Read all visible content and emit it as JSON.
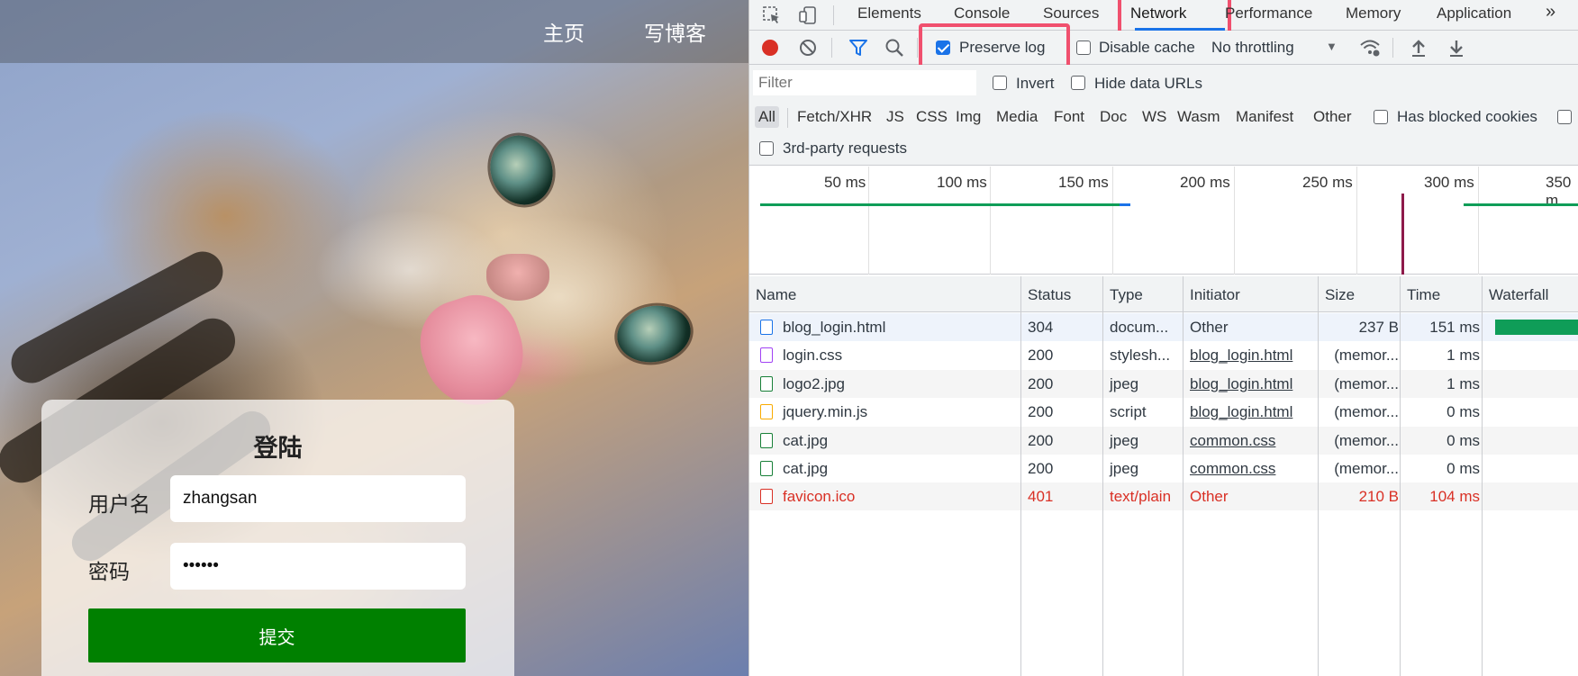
{
  "page": {
    "nav": {
      "home": "主页",
      "write": "写博客"
    },
    "login": {
      "title": "登陆",
      "username_label": "用户名",
      "username_value": "zhangsan",
      "password_label": "密码",
      "password_value": "••••••",
      "submit_label": "提交"
    }
  },
  "devtools": {
    "tabs": [
      "Elements",
      "Console",
      "Sources",
      "Network",
      "Performance",
      "Memory",
      "Application"
    ],
    "active_tab": "Network",
    "more_tabs": "»",
    "toolbar": {
      "preserve_log": "Preserve log",
      "disable_cache": "Disable cache",
      "throttling": "No throttling"
    },
    "filter": {
      "placeholder": "Filter",
      "invert": "Invert",
      "hide_data_urls": "Hide data URLs"
    },
    "types": [
      "All",
      "Fetch/XHR",
      "JS",
      "CSS",
      "Img",
      "Media",
      "Font",
      "Doc",
      "WS",
      "Wasm",
      "Manifest",
      "Other"
    ],
    "has_blocked_cookies": "Has blocked cookies",
    "third_party": "3rd-party requests",
    "overview_ticks": [
      "50 ms",
      "100 ms",
      "150 ms",
      "200 ms",
      "250 ms",
      "300 ms",
      "350 m"
    ],
    "columns": [
      "Name",
      "Status",
      "Type",
      "Initiator",
      "Size",
      "Time",
      "Waterfall"
    ],
    "rows": [
      {
        "name": "blog_login.html",
        "status": "304",
        "type": "docum...",
        "initiator": "Other",
        "size": "237 B",
        "time": "151 ms",
        "icon": "document-icon",
        "error": false
      },
      {
        "name": "login.css",
        "status": "200",
        "type": "stylesh...",
        "initiator": "blog_login.html",
        "size": "(memor...",
        "time": "1 ms",
        "icon": "stylesheet-icon",
        "error": false
      },
      {
        "name": "logo2.jpg",
        "status": "200",
        "type": "jpeg",
        "initiator": "blog_login.html",
        "size": "(memor...",
        "time": "1 ms",
        "icon": "image-icon",
        "error": false
      },
      {
        "name": "jquery.min.js",
        "status": "200",
        "type": "script",
        "initiator": "blog_login.html",
        "size": "(memor...",
        "time": "0 ms",
        "icon": "script-icon",
        "error": false
      },
      {
        "name": "cat.jpg",
        "status": "200",
        "type": "jpeg",
        "initiator": "common.css",
        "size": "(memor...",
        "time": "0 ms",
        "icon": "image-icon",
        "error": false
      },
      {
        "name": "cat.jpg",
        "status": "200",
        "type": "jpeg",
        "initiator": "common.css",
        "size": "(memor...",
        "time": "0 ms",
        "icon": "image-icon",
        "error": false
      },
      {
        "name": "favicon.ico",
        "status": "401",
        "type": "text/plain",
        "initiator": "Other",
        "size": "210 B",
        "time": "104 ms",
        "icon": "file-icon",
        "error": true
      }
    ],
    "colors": {
      "highlight": "#f0506e",
      "accent": "#1a73e8",
      "record": "#d93025",
      "error": "#d93025",
      "timing_bar": "#0f9d58"
    }
  }
}
